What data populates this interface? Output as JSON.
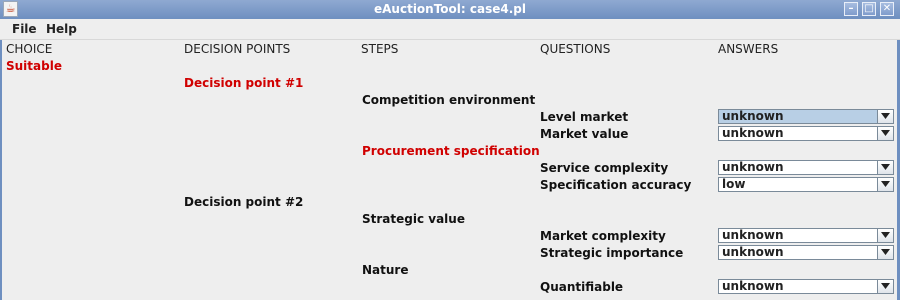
{
  "window": {
    "title": "eAuctionTool: case4.pl"
  },
  "menu": {
    "items": [
      "File",
      "Help"
    ]
  },
  "headers": {
    "choice": "CHOICE",
    "decision_points": "DECISION POINTS",
    "steps": "STEPS",
    "questions": "QUESTIONS",
    "answers": "ANSWERS"
  },
  "choice": {
    "label": "Suitable",
    "color": "#d00000"
  },
  "decision_points": [
    {
      "label": "Decision point #1",
      "color": "#d00000"
    },
    {
      "label": "Decision point #2",
      "color": "#111111"
    }
  ],
  "steps": [
    {
      "label": "Competition environment",
      "color": "#111111"
    },
    {
      "label": "Procurement specification",
      "color": "#d00000"
    },
    {
      "label": "Strategic value",
      "color": "#111111"
    },
    {
      "label": "Nature",
      "color": "#111111"
    }
  ],
  "questions": [
    {
      "label": "Level market",
      "answer": "unknown",
      "selected": true
    },
    {
      "label": "Market value",
      "answer": "unknown",
      "selected": false
    },
    {
      "label": "Service complexity",
      "answer": "unknown",
      "selected": false
    },
    {
      "label": "Specification accuracy",
      "answer": "low",
      "selected": false
    },
    {
      "label": "Market complexity",
      "answer": "unknown",
      "selected": false
    },
    {
      "label": "Strategic importance",
      "answer": "unknown",
      "selected": false
    },
    {
      "label": "Quantifiable",
      "answer": "unknown",
      "selected": false
    }
  ]
}
